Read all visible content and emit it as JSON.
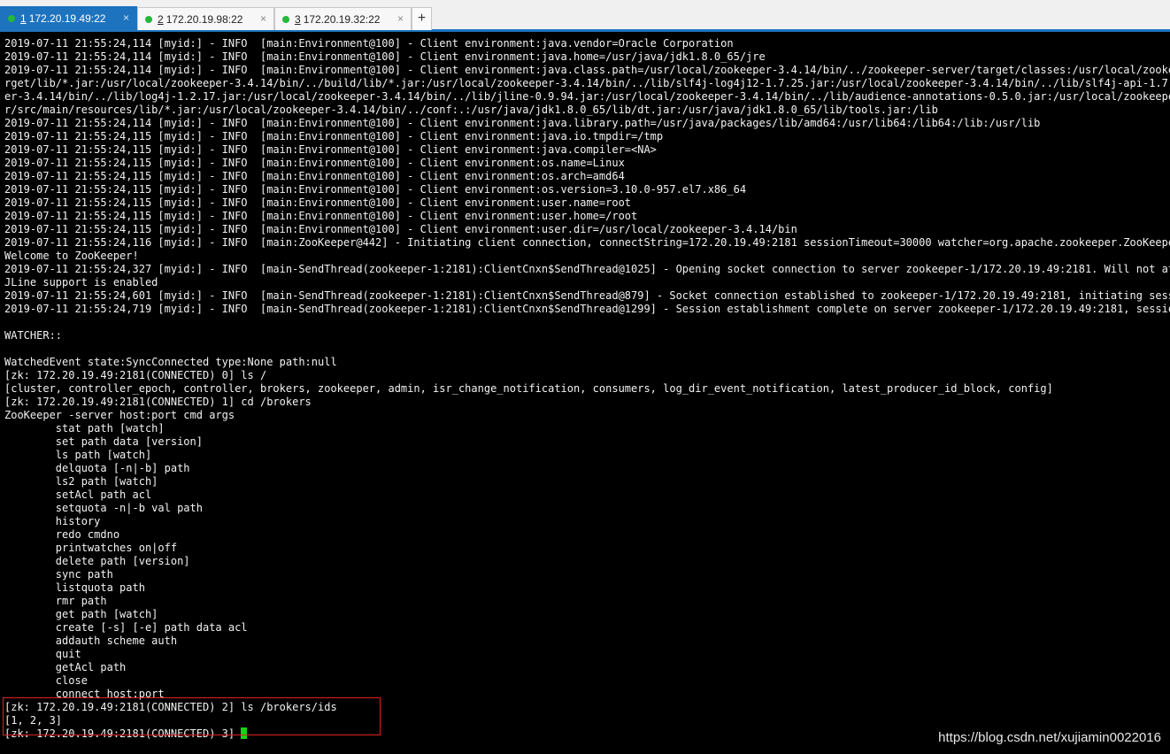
{
  "tabs": [
    {
      "number": "1",
      "title": "172.20.19.49:22",
      "active": true
    },
    {
      "number": "2",
      "title": "172.20.19.98:22",
      "active": false
    },
    {
      "number": "3",
      "title": "172.20.19.32:22",
      "active": false
    }
  ],
  "tab_close_glyph": "×",
  "new_tab_glyph": "+",
  "colors": {
    "tab_active": "#1e73be",
    "status_dot": "#25b83a",
    "terminal_bg": "#000000",
    "terminal_fg": "#f2f2f2",
    "cursor": "#16d416",
    "highlight_border": "#e02020"
  },
  "terminal": {
    "output": "2019-07-11 21:55:24,114 [myid:] - INFO  [main:Environment@100] - Client environment:java.vendor=Oracle Corporation\n2019-07-11 21:55:24,114 [myid:] - INFO  [main:Environment@100] - Client environment:java.home=/usr/java/jdk1.8.0_65/jre\n2019-07-11 21:55:24,114 [myid:] - INFO  [main:Environment@100] - Client environment:java.class.path=/usr/local/zookeeper-3.4.14/bin/../zookeeper-server/target/classes:/usr/local/zookeeper-\nrget/lib/*.jar:/usr/local/zookeeper-3.4.14/bin/../build/lib/*.jar:/usr/local/zookeeper-3.4.14/bin/../lib/slf4j-log4j12-1.7.25.jar:/usr/local/zookeeper-3.4.14/bin/../lib/slf4j-api-1.7.25.ja\ner-3.4.14/bin/../lib/log4j-1.2.17.jar:/usr/local/zookeeper-3.4.14/bin/../lib/jline-0.9.94.jar:/usr/local/zookeeper-3.4.14/bin/../lib/audience-annotations-0.5.0.jar:/usr/local/zookeeper-3.4\nr/src/main/resources/lib/*.jar:/usr/local/zookeeper-3.4.14/bin/../conf:.:/usr/java/jdk1.8.0_65/lib/dt.jar:/usr/java/jdk1.8.0_65/lib/tools.jar:/lib\n2019-07-11 21:55:24,114 [myid:] - INFO  [main:Environment@100] - Client environment:java.library.path=/usr/java/packages/lib/amd64:/usr/lib64:/lib64:/lib:/usr/lib\n2019-07-11 21:55:24,115 [myid:] - INFO  [main:Environment@100] - Client environment:java.io.tmpdir=/tmp\n2019-07-11 21:55:24,115 [myid:] - INFO  [main:Environment@100] - Client environment:java.compiler=<NA>\n2019-07-11 21:55:24,115 [myid:] - INFO  [main:Environment@100] - Client environment:os.name=Linux\n2019-07-11 21:55:24,115 [myid:] - INFO  [main:Environment@100] - Client environment:os.arch=amd64\n2019-07-11 21:55:24,115 [myid:] - INFO  [main:Environment@100] - Client environment:os.version=3.10.0-957.el7.x86_64\n2019-07-11 21:55:24,115 [myid:] - INFO  [main:Environment@100] - Client environment:user.name=root\n2019-07-11 21:55:24,115 [myid:] - INFO  [main:Environment@100] - Client environment:user.home=/root\n2019-07-11 21:55:24,115 [myid:] - INFO  [main:Environment@100] - Client environment:user.dir=/usr/local/zookeeper-3.4.14/bin\n2019-07-11 21:55:24,116 [myid:] - INFO  [main:ZooKeeper@442] - Initiating client connection, connectString=172.20.19.49:2181 sessionTimeout=30000 watcher=org.apache.zookeeper.ZooKeeperMain\nWelcome to ZooKeeper!\n2019-07-11 21:55:24,327 [myid:] - INFO  [main-SendThread(zookeeper-1:2181):ClientCnxn$SendThread@1025] - Opening socket connection to server zookeeper-1/172.20.19.49:2181. Will not attempt\nJLine support is enabled\n2019-07-11 21:55:24,601 [myid:] - INFO  [main-SendThread(zookeeper-1:2181):ClientCnxn$SendThread@879] - Socket connection established to zookeeper-1/172.20.19.49:2181, initiating session\n2019-07-11 21:55:24,719 [myid:] - INFO  [main-SendThread(zookeeper-1:2181):ClientCnxn$SendThread@1299] - Session establishment complete on server zookeeper-1/172.20.19.49:2181, sessionid =\n\nWATCHER::\n\nWatchedEvent state:SyncConnected type:None path:null\n[zk: 172.20.19.49:2181(CONNECTED) 0] ls /\n[cluster, controller_epoch, controller, brokers, zookeeper, admin, isr_change_notification, consumers, log_dir_event_notification, latest_producer_id_block, config]\n[zk: 172.20.19.49:2181(CONNECTED) 1] cd /brokers\nZooKeeper -server host:port cmd args\n\tstat path [watch]\n\tset path data [version]\n\tls path [watch]\n\tdelquota [-n|-b] path\n\tls2 path [watch]\n\tsetAcl path acl\n\tsetquota -n|-b val path\n\thistory \n\tredo cmdno\n\tprintwatches on|off\n\tdelete path [version]\n\tsync path\n\tlistquota path\n\trmr path\n\tget path [watch]\n\tcreate [-s] [-e] path data acl\n\taddauth scheme auth\n\tquit \n\tgetAcl path\n\tclose \n\tconnect host:port\n[zk: 172.20.19.49:2181(CONNECTED) 2] ls /brokers/ids\n[1, 2, 3]\n[zk: 172.20.19.49:2181(CONNECTED) 3] ",
    "prompt_note": ""
  },
  "watermark": "https://blog.csdn.net/xujiamin0022016"
}
